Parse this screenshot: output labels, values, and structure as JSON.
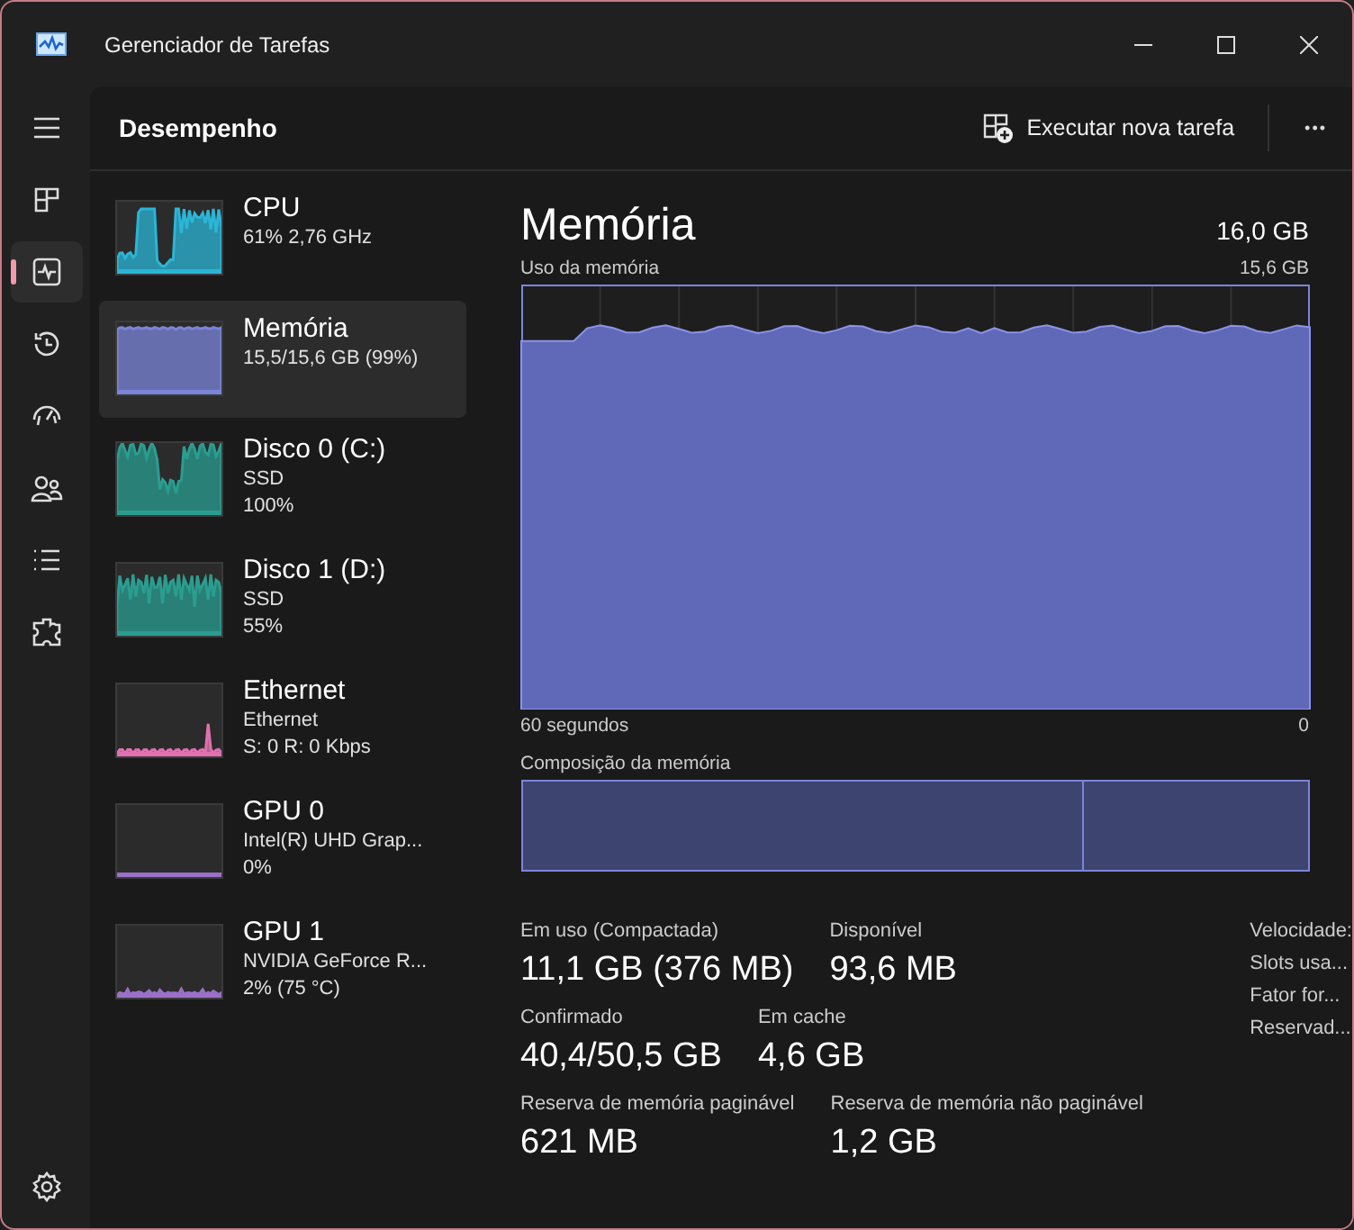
{
  "window": {
    "title": "Gerenciador de Tarefas"
  },
  "nav": [
    {
      "kind": "menu",
      "selected": false
    },
    {
      "kind": "processes",
      "selected": false
    },
    {
      "kind": "performance",
      "selected": true
    },
    {
      "kind": "history",
      "selected": false
    },
    {
      "kind": "startup",
      "selected": false
    },
    {
      "kind": "users",
      "selected": false
    },
    {
      "kind": "details",
      "selected": false
    },
    {
      "kind": "services",
      "selected": false
    },
    {
      "kind": "settings",
      "selected": false
    }
  ],
  "header": {
    "title": "Desempenho",
    "run_task": "Executar nova tarefa",
    "more": "•••"
  },
  "devices": [
    {
      "kind": "cpu",
      "name": "CPU",
      "lines": [
        "61% 2,76 GHz"
      ],
      "color": "#2bb5d6",
      "selected": false
    },
    {
      "kind": "memory",
      "name": "Memória",
      "lines": [
        "15,5/15,6 GB (99%)"
      ],
      "color": "#7b85d9",
      "selected": true
    },
    {
      "kind": "disk",
      "name": "Disco 0 (C:)",
      "lines": [
        "SSD",
        "100%"
      ],
      "color": "#2a9d90",
      "selected": false
    },
    {
      "kind": "disk2",
      "name": "Disco 1 (D:)",
      "lines": [
        "SSD",
        "55%"
      ],
      "color": "#2a9d90",
      "selected": false
    },
    {
      "kind": "net",
      "name": "Ethernet",
      "lines": [
        "Ethernet",
        "S: 0 R: 0 Kbps"
      ],
      "color": "#e070b0",
      "selected": false
    },
    {
      "kind": "flat",
      "name": "GPU 0",
      "lines": [
        "Intel(R) UHD Grap...",
        "0%"
      ],
      "color": "#9a70c8",
      "selected": false
    },
    {
      "kind": "low",
      "name": "GPU 1",
      "lines": [
        "NVIDIA GeForce R...",
        "2%  (75 °C)"
      ],
      "color": "#9a70c8",
      "selected": false
    }
  ],
  "main": {
    "title": "Memória",
    "total": "16,0 GB",
    "graph_label": "Uso da memória",
    "graph_max": "15,6 GB",
    "graph_time": "60 segundos",
    "graph_min": "0",
    "composition_label": "Composição da memória",
    "stats": [
      [
        {
          "label": "Em uso (Compactada)",
          "value": "11,1 GB (376 MB)"
        },
        {
          "label": "Disponível",
          "value": "93,6 MB"
        }
      ],
      [
        {
          "label": "Confirmado",
          "value": "40,4/50,5 GB"
        },
        {
          "label": "Em cache",
          "value": "4,6 GB"
        }
      ],
      [
        {
          "label": "Reserva de memória paginável",
          "value": "621 MB"
        },
        {
          "label": "Reserva de memória não paginável",
          "value": "1,2 GB"
        }
      ]
    ],
    "side_labels": [
      "Velocidade:",
      "Slots usa...",
      "Fator for...",
      "Reservad..."
    ]
  }
}
